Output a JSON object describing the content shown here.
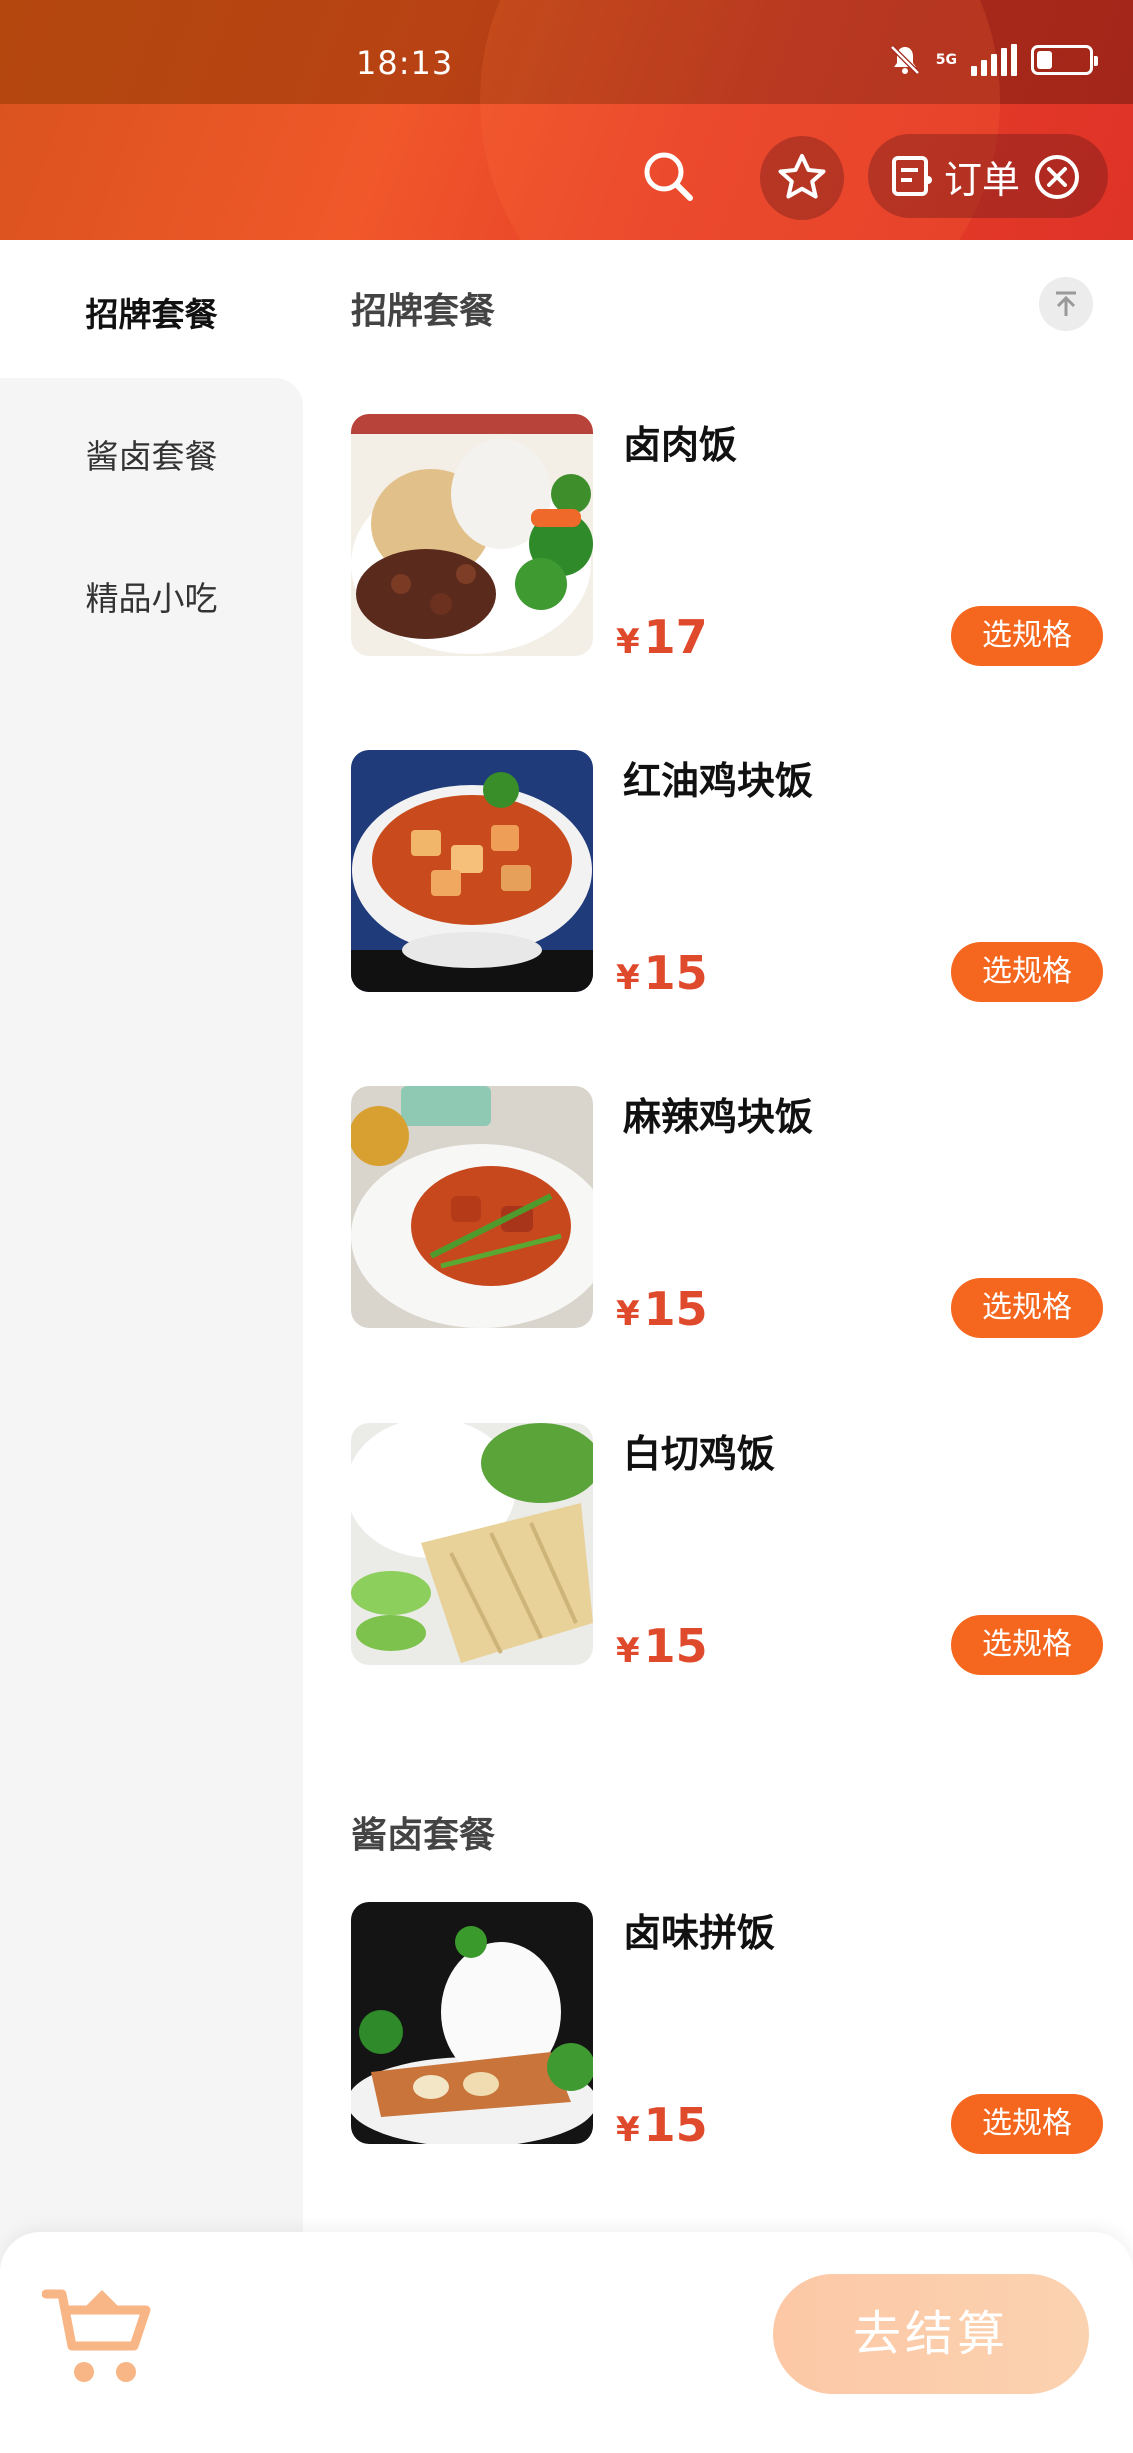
{
  "status_bar": {
    "time": "18:13",
    "network": "5G",
    "battery": "5"
  },
  "header": {
    "order_label": "订单"
  },
  "sidebar": {
    "items": [
      {
        "label": "招牌套餐"
      },
      {
        "label": "酱卤套餐"
      },
      {
        "label": "精品小吃"
      }
    ]
  },
  "main": {
    "sections": [
      {
        "title": "招牌套餐",
        "dishes": [
          {
            "name": "卤肉饭",
            "currency": "¥",
            "price": "17",
            "button": "选规格"
          },
          {
            "name": "红油鸡块饭",
            "currency": "¥",
            "price": "15",
            "button": "选规格"
          },
          {
            "name": "麻辣鸡块饭",
            "currency": "¥",
            "price": "15",
            "button": "选规格"
          },
          {
            "name": "白切鸡饭",
            "currency": "¥",
            "price": "15",
            "button": "选规格"
          }
        ]
      },
      {
        "title": "酱卤套餐",
        "dishes": [
          {
            "name": "卤味拼饭",
            "currency": "¥",
            "price": "15",
            "button": "选规格"
          }
        ]
      }
    ]
  },
  "cart": {
    "checkout_label": "去结算"
  },
  "colors": {
    "accent": "#f5661e",
    "price": "#e04a2c",
    "header": "#e8402a"
  }
}
